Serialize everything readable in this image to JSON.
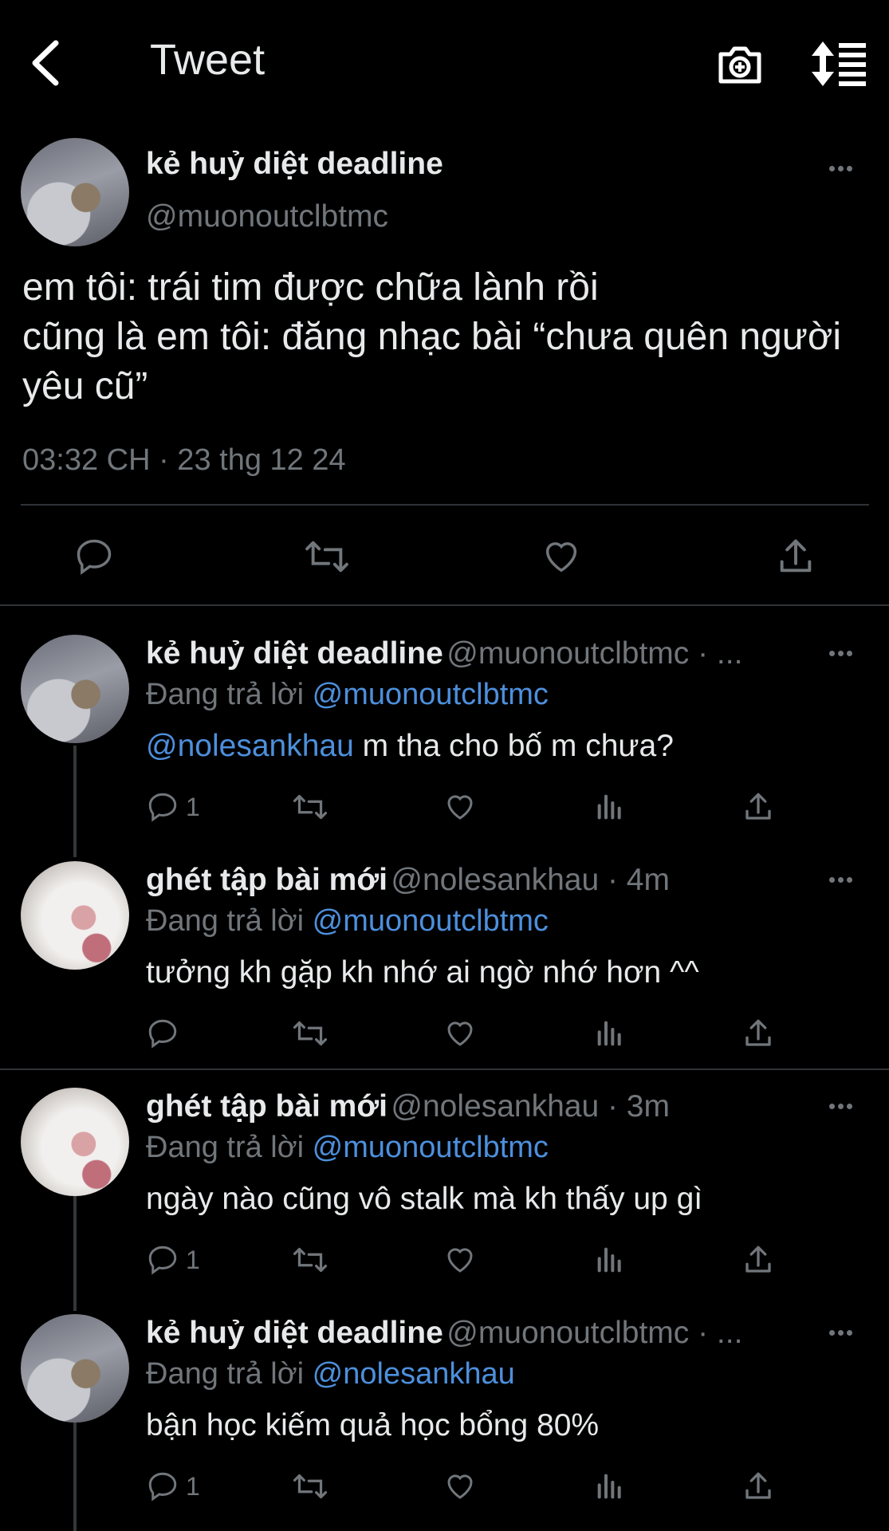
{
  "header": {
    "title": "Tweet",
    "back_icon": "chevron-left-icon",
    "camera_icon": "camera-add-icon",
    "sort_icon": "sort-list-icon"
  },
  "colors": {
    "background": "#000000",
    "text": "#e7e9ea",
    "muted": "#71767b",
    "link": "#4d8fdc",
    "divider": "#2f3336"
  },
  "main_tweet": {
    "author_name": "kẻ huỷ diệt deadline",
    "author_handle": "@muonoutclbtmc",
    "text": "em tôi: trái tim được chữa lành rồi\ncũng là em tôi: đăng nhạc bài “chưa quên người yêu cũ”",
    "timestamp": "03:32 CH · 23 thg 12 24"
  },
  "replies": [
    {
      "author_name": "kẻ huỷ diệt deadline",
      "meta": "@muonoutclbtmc · ...",
      "replying_prefix": "Đang trả lời",
      "replying_to": "@muonoutclbtmc",
      "mention": "@nolesankhau",
      "text": " m tha cho bố m chưa?",
      "reply_count": "1"
    },
    {
      "author_name": "ghét tập bài mới",
      "meta": "@nolesankhau · 4m",
      "replying_prefix": "Đang trả lời",
      "replying_to": "@muonoutclbtmc",
      "text": "tưởng kh gặp kh nhớ ai ngờ nhớ hơn ^^",
      "reply_count": ""
    },
    {
      "author_name": "ghét tập bài mới",
      "meta": "@nolesankhau · 3m",
      "replying_prefix": "Đang trả lời",
      "replying_to": "@muonoutclbtmc",
      "text": "ngày nào cũng vô stalk mà kh thấy up gì",
      "reply_count": "1"
    },
    {
      "author_name": "kẻ huỷ diệt deadline",
      "meta": "@muonoutclbtmc · ...",
      "replying_prefix": "Đang trả lời",
      "replying_to": "@nolesankhau",
      "text": "bận học kiếm quả học bổng 80%",
      "reply_count": "1"
    }
  ]
}
